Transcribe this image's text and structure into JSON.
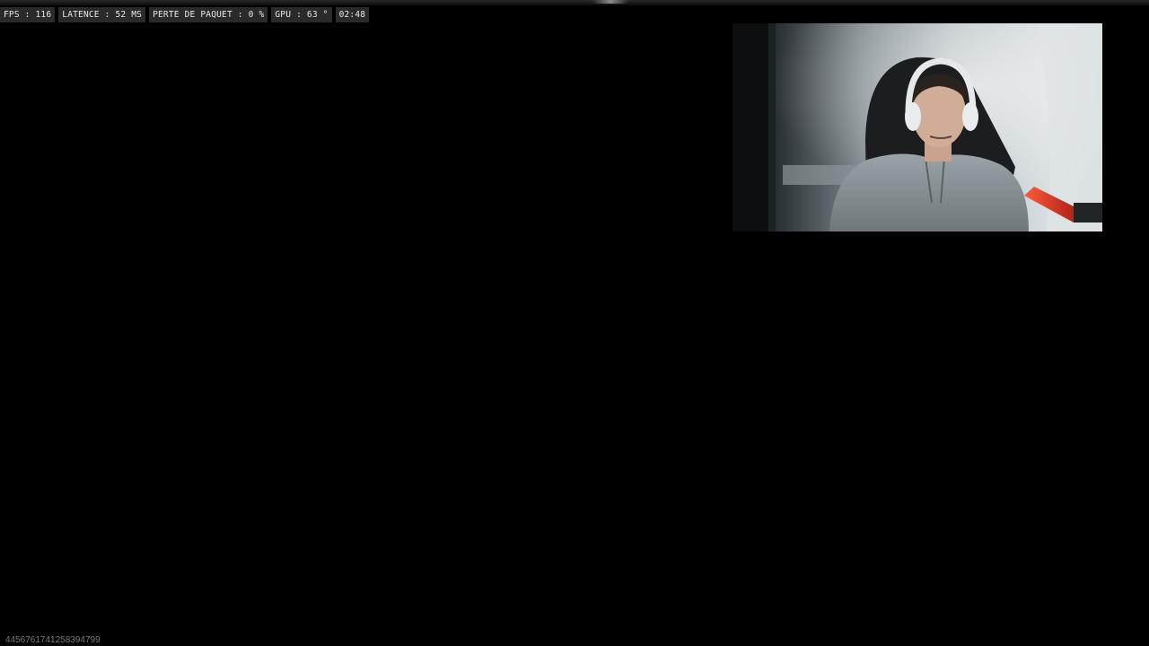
{
  "overlay": {
    "fps": "FPS : 116",
    "latency": "LATENCE : 52 MS",
    "packet_loss": "PERTE DE PAQUET : 0 %",
    "gpu": "GPU : 63 °",
    "clock": "02:48"
  },
  "webcam": {
    "icon": "webcam-feed"
  },
  "footer": {
    "session_id": "4456761741258394799"
  },
  "colors": {
    "background": "#000000",
    "stat_bg": "#2a2a2a",
    "stat_text": "#e8e8e8",
    "mic_red": "#d63020"
  }
}
